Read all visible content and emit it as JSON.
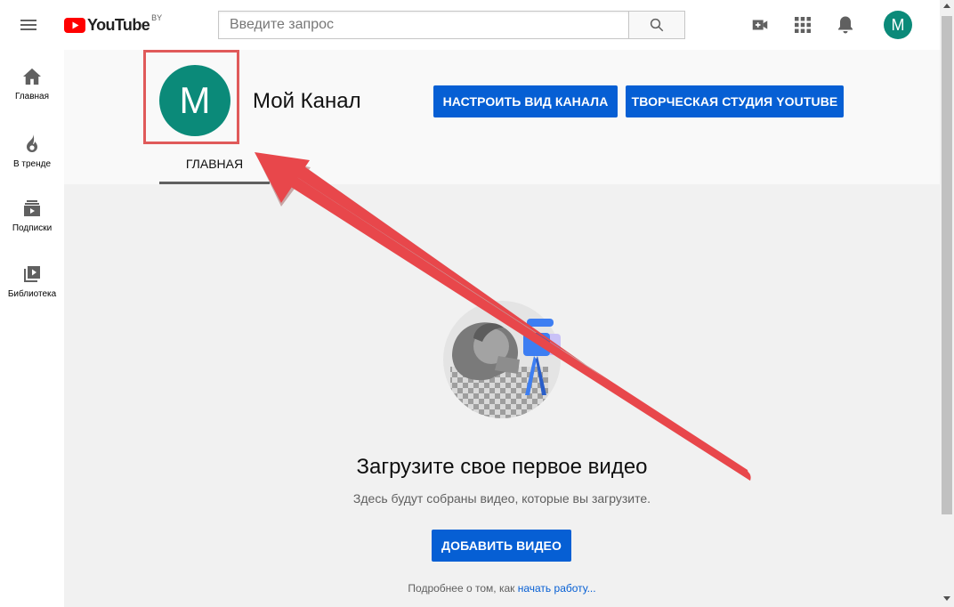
{
  "header": {
    "logo_text": "YouTube",
    "logo_region": "BY",
    "search_placeholder": "Введите запрос",
    "icons": [
      "menu-icon",
      "search-icon",
      "create-video-icon",
      "apps-icon",
      "notifications-icon"
    ],
    "avatar_letter": "M"
  },
  "sidebar": {
    "items": [
      {
        "label": "Главная",
        "icon": "home-icon"
      },
      {
        "label": "В тренде",
        "icon": "trending-icon"
      },
      {
        "label": "Подписки",
        "icon": "subscriptions-icon"
      },
      {
        "label": "Библиотека",
        "icon": "library-icon"
      }
    ]
  },
  "channel": {
    "avatar_letter": "M",
    "name": "Мой Канал",
    "customize_button": "НАСТРОИТЬ ВИД КАНАЛА",
    "studio_button": "ТВОРЧЕСКАЯ СТУДИЯ YOUTUBE",
    "tabs": [
      {
        "label": "ГЛАВНАЯ",
        "active": true
      }
    ]
  },
  "empty_state": {
    "title": "Загрузите свое первое видео",
    "subtitle": "Здесь будут собраны видео, которые вы загрузите.",
    "add_button": "ДОБАВИТЬ ВИДЕО",
    "more_prefix": "Подробнее о том, как ",
    "more_link": "начать работу..."
  },
  "colors": {
    "brand_red": "#ff0000",
    "accent_blue": "#065fd4",
    "avatar_teal": "#0b8a79",
    "annotation_red": "#e8474b"
  }
}
